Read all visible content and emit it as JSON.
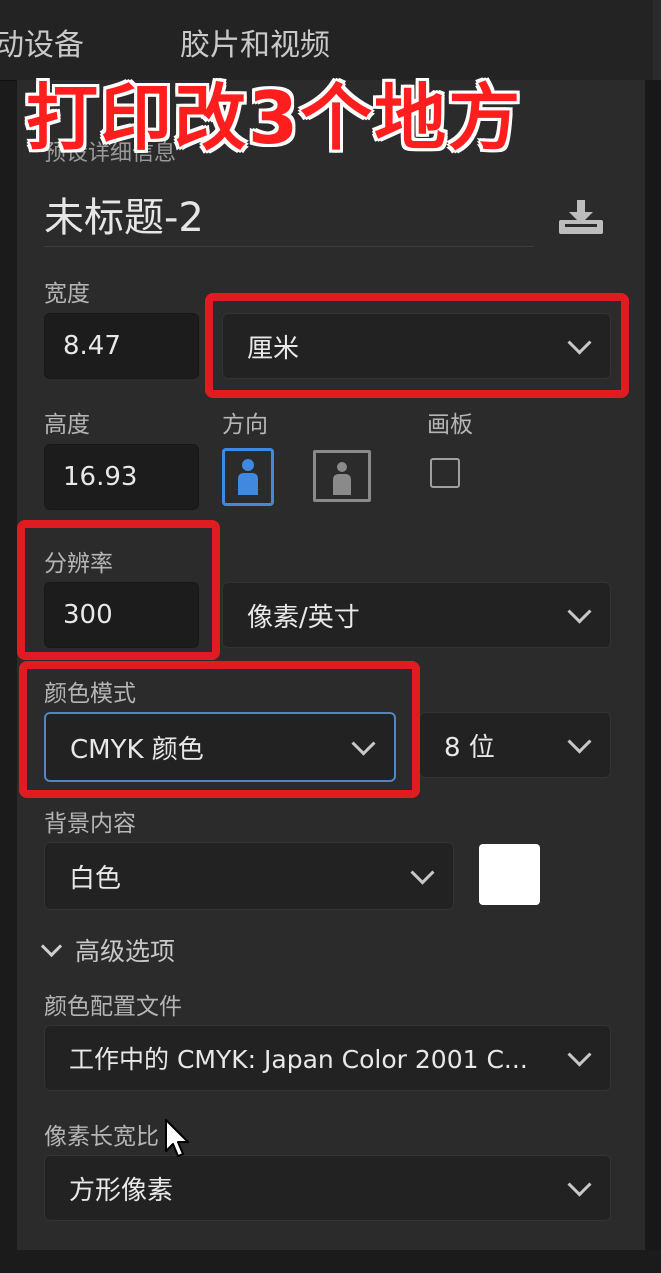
{
  "header": {
    "tabs": [
      {
        "label": "动设备"
      },
      {
        "label": "胶片和视频"
      }
    ]
  },
  "overlay_caption": "打印改3个地方",
  "panel": {
    "section_hint": "预设详细信息",
    "document_name": "未标题-2",
    "width": {
      "label": "宽度",
      "value": "8.47",
      "unit": "厘米"
    },
    "height": {
      "label": "高度",
      "value": "16.93"
    },
    "orientation": {
      "label": "方向"
    },
    "artboard": {
      "label": "画板",
      "checked": false
    },
    "resolution": {
      "label": "分辨率",
      "value": "300",
      "unit": "像素/英寸"
    },
    "color_mode": {
      "label": "颜色模式",
      "value": "CMYK 颜色",
      "bit_depth": "8 位"
    },
    "background": {
      "label": "背景内容",
      "value": "白色",
      "swatch_color": "#ffffff"
    },
    "advanced": {
      "toggle_label": "高级选项",
      "profile": {
        "label": "颜色配置文件",
        "value": "工作中的 CMYK: Japan Color 2001 C..."
      },
      "pixel_aspect": {
        "label": "像素长宽比",
        "value": "方形像素"
      }
    }
  },
  "colors": {
    "panel_bg": "#2b2b2b",
    "field_bg": "#1c1c1c",
    "accent_blue": "#3f8ae0",
    "highlight_red": "#e11b22"
  },
  "icons": [
    "save-preset-icon",
    "portrait-orientation-icon",
    "landscape-orientation-icon",
    "chevron-down-icon",
    "mouse-cursor-icon"
  ]
}
